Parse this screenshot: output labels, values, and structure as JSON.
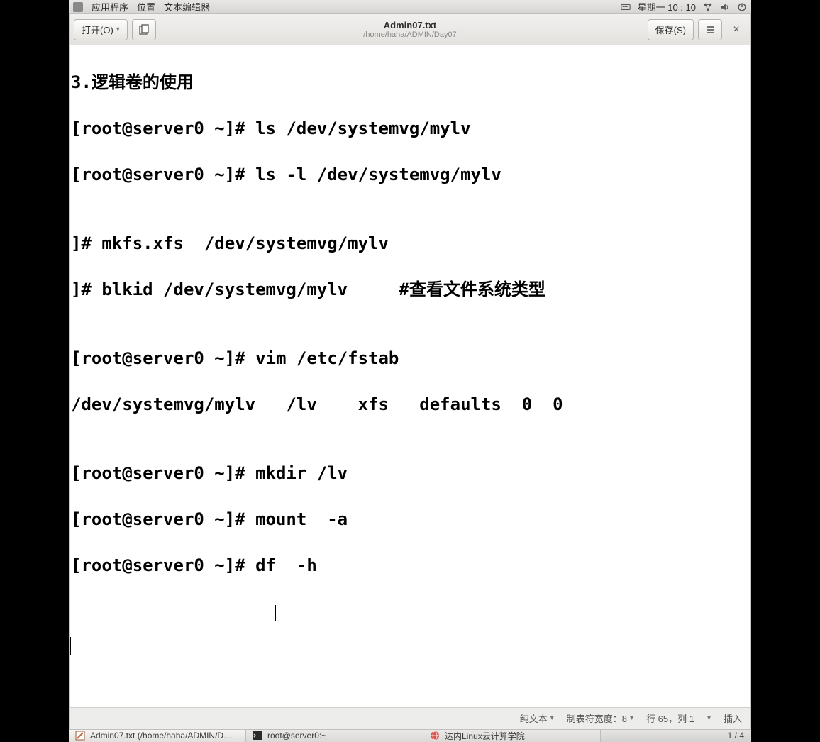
{
  "panel": {
    "apps": "应用程序",
    "places": "位置",
    "editor": "文本编辑器",
    "datetime": "星期一 10 : 10"
  },
  "toolbar": {
    "open": "打开(O)",
    "save": "保存(S)",
    "title": "Admin07.txt",
    "subtitle": "/home/haha/ADMIN/Day07"
  },
  "content": {
    "l1": "3.逻辑卷的使用",
    "l2": "[root@server0 ~]# ls /dev/systemvg/mylv",
    "l3": "[root@server0 ~]# ls -l /dev/systemvg/mylv",
    "l4": "",
    "l5": "]# mkfs.xfs  /dev/systemvg/mylv",
    "l6": "]# blkid /dev/systemvg/mylv     #查看文件系统类型",
    "l7": "",
    "l8": "[root@server0 ~]# vim /etc/fstab",
    "l9": "/dev/systemvg/mylv   /lv    xfs   defaults  0  0",
    "l10": "",
    "l11": "[root@server0 ~]# mkdir /lv",
    "l12": "[root@server0 ~]# mount  -a",
    "l13": "[root@server0 ~]# df  -h"
  },
  "status": {
    "syntax": "纯文本",
    "tabwidth": "制表符宽度：8",
    "position": "行 65，列 1",
    "mode": "插入"
  },
  "taskbar": {
    "t1": "Admin07.txt (/home/haha/ADMIN/D…",
    "t2": "root@server0:~",
    "t3": "达内Linux云计算学院",
    "pages": "1 / 4"
  }
}
